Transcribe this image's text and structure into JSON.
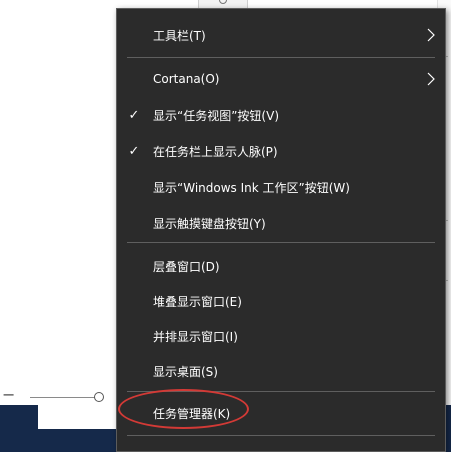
{
  "menu": {
    "items": [
      {
        "label": "工具栏(T)",
        "checked": false,
        "has_submenu": true
      },
      {
        "label": "Cortana(O)",
        "checked": false,
        "has_submenu": true
      },
      {
        "label": "显示“任务视图”按钮(V)",
        "checked": true,
        "has_submenu": false
      },
      {
        "label": "在任务栏上显示人脉(P)",
        "checked": true,
        "has_submenu": false
      },
      {
        "label": "显示“Windows Ink 工作区”按钮(W)",
        "checked": false,
        "has_submenu": false
      },
      {
        "label": "显示触摸键盘按钮(Y)",
        "checked": false,
        "has_submenu": false
      },
      {
        "label": "层叠窗口(D)",
        "checked": false,
        "has_submenu": false
      },
      {
        "label": "堆叠显示窗口(E)",
        "checked": false,
        "has_submenu": false
      },
      {
        "label": "并排显示窗口(I)",
        "checked": false,
        "has_submenu": false
      },
      {
        "label": "显示桌面(S)",
        "checked": false,
        "has_submenu": false
      },
      {
        "label": "任务管理器(K)",
        "checked": false,
        "has_submenu": false
      }
    ],
    "check_glyph": "✓",
    "highlighted_item": "任务管理器(K)"
  },
  "zoom": {
    "minus_glyph": "−"
  },
  "colors": {
    "menu_bg": "#2b2b2b",
    "menu_text": "#ffffff",
    "separator": "#5f5f5f",
    "highlight_ring": "#d33a36",
    "taskbar": "#15294a"
  },
  "icons": {
    "submenu": "chevron-right-icon",
    "check": "checkmark-icon"
  }
}
